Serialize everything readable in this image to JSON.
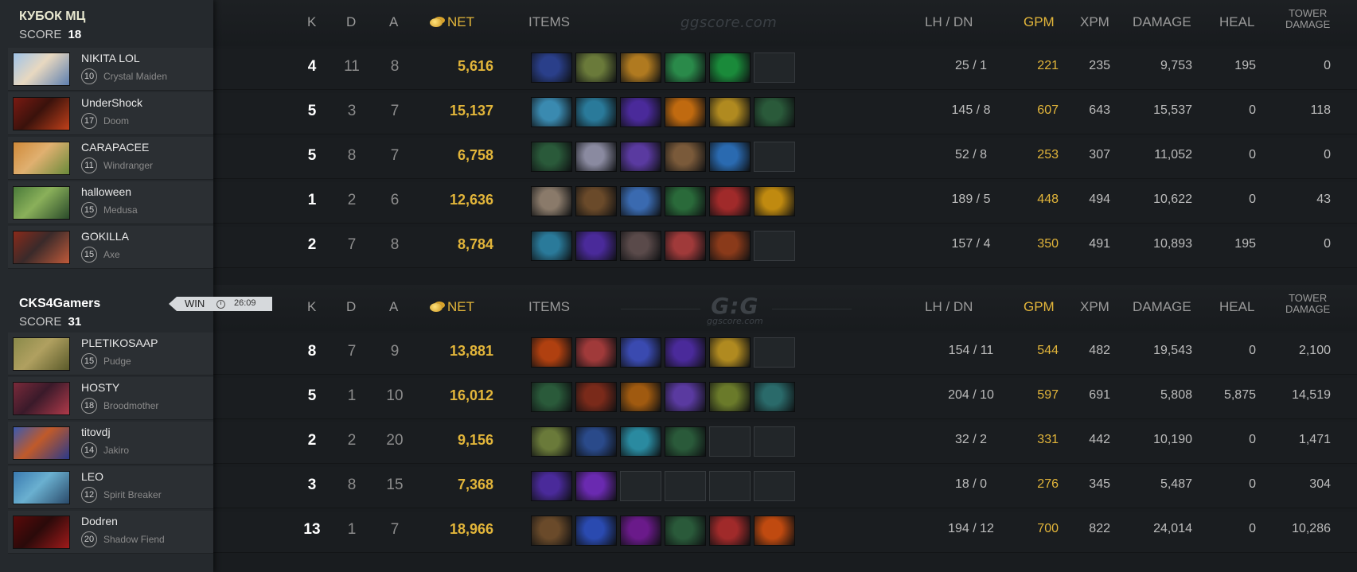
{
  "columns": {
    "k": "K",
    "d": "D",
    "a": "A",
    "net": "NET",
    "items": "ITEMS",
    "lhdn": "LH  /  DN",
    "gpm": "GPM",
    "xpm": "XPM",
    "damage": "DAMAGE",
    "heal": "HEAL",
    "tower_line1": "TOWER",
    "tower_line2": "DAMAGE"
  },
  "watermark_top": "ggscore.com",
  "watermark_mid_big": "G:G",
  "watermark_mid_small": "ggscore.com",
  "result": {
    "label": "WIN",
    "time": "26:09"
  },
  "teams": [
    {
      "name": "КУБОК МЦ",
      "score_label": "SCORE",
      "score": "18",
      "players": [
        {
          "name": "NIKITA LOL",
          "level": "10",
          "hero": "Crystal Maiden",
          "k": "4",
          "d": "11",
          "a": "8",
          "net": "5,616",
          "lhdn": "25  /  1",
          "gpm": "221",
          "xpm": "235",
          "damage": "9,753",
          "heal": "195",
          "tower": "0",
          "avatar": [
            "#9fc3e8",
            "#e8d8c0",
            "#5d7fb0"
          ],
          "items": [
            "#2a3f8a",
            "#6a7a3a",
            "#b07a20",
            "#2a8a4a",
            "#1a8a3a",
            "empty"
          ]
        },
        {
          "name": "UnderShock",
          "level": "17",
          "hero": "Doom",
          "k": "5",
          "d": "3",
          "a": "7",
          "net": "15,137",
          "lhdn": "145  /  8",
          "gpm": "607",
          "xpm": "643",
          "damage": "15,537",
          "heal": "0",
          "tower": "118",
          "avatar": [
            "#7a1a12",
            "#3a120c",
            "#c0401a"
          ],
          "items": [
            "#3a8ab0",
            "#2a7a9a",
            "#4a2a9a",
            "#c06a10",
            "#b08a20",
            "#2a5a3a"
          ]
        },
        {
          "name": "CARAPACEE",
          "level": "11",
          "hero": "Windranger",
          "k": "5",
          "d": "8",
          "a": "7",
          "net": "6,758",
          "lhdn": "52  /  8",
          "gpm": "253",
          "xpm": "307",
          "damage": "11,052",
          "heal": "0",
          "tower": "0",
          "avatar": [
            "#d08a3a",
            "#e0b070",
            "#6a8a3a"
          ],
          "items": [
            "#2a5a3a",
            "#8a8aa0",
            "#5a3aa0",
            "#7a5a3a",
            "#2a6ab0",
            "empty"
          ]
        },
        {
          "name": "halloween",
          "level": "15",
          "hero": "Medusa",
          "k": "1",
          "d": "2",
          "a": "6",
          "net": "12,636",
          "lhdn": "189  /  5",
          "gpm": "448",
          "xpm": "494",
          "damage": "10,622",
          "heal": "0",
          "tower": "43",
          "avatar": [
            "#4a7a3a",
            "#8ab05a",
            "#2a4a2a"
          ],
          "items": [
            "#8a7a6a",
            "#6a4a2a",
            "#3a6ab0",
            "#2a6a3a",
            "#a02a2a",
            "#c08a10"
          ]
        },
        {
          "name": "GOKILLA",
          "level": "15",
          "hero": "Axe",
          "k": "2",
          "d": "7",
          "a": "8",
          "net": "8,784",
          "lhdn": "157  /  4",
          "gpm": "350",
          "xpm": "491",
          "damage": "10,893",
          "heal": "195",
          "tower": "0",
          "avatar": [
            "#8a2a1a",
            "#3a2a2a",
            "#c05a3a"
          ],
          "items": [
            "#2a7a9a",
            "#4a2a9a",
            "#5a4a4a",
            "#a03a3a",
            "#8a3a1a",
            "empty"
          ]
        }
      ]
    },
    {
      "name": "CKS4Gamers",
      "score_label": "SCORE",
      "score": "31",
      "players": [
        {
          "name": "PLETIKOSAAP",
          "level": "15",
          "hero": "Pudge",
          "k": "8",
          "d": "7",
          "a": "9",
          "net": "13,881",
          "lhdn": "154  /  11",
          "gpm": "544",
          "xpm": "482",
          "damage": "19,543",
          "heal": "0",
          "tower": "2,100",
          "avatar": [
            "#8a8a4a",
            "#b0a060",
            "#5a5a2a"
          ],
          "items": [
            "#b04010",
            "#a03a3a",
            "#3a4ab0",
            "#4a2a9a",
            "#b08a20",
            "empty"
          ]
        },
        {
          "name": "HOSTY",
          "level": "18",
          "hero": "Broodmother",
          "k": "5",
          "d": "1",
          "a": "10",
          "net": "16,012",
          "lhdn": "204  /  10",
          "gpm": "597",
          "xpm": "691",
          "damage": "5,808",
          "heal": "5,875",
          "tower": "14,519",
          "avatar": [
            "#7a2a3a",
            "#3a1a2a",
            "#b03a4a"
          ],
          "items": [
            "#2a5a3a",
            "#7a2a1a",
            "#a05a10",
            "#5a3aa0",
            "#6a7a2a",
            "#2a6a6a"
          ]
        },
        {
          "name": "titovdj",
          "level": "14",
          "hero": "Jakiro",
          "k": "2",
          "d": "2",
          "a": "20",
          "net": "9,156",
          "lhdn": "32  /  2",
          "gpm": "331",
          "xpm": "442",
          "damage": "10,190",
          "heal": "0",
          "tower": "1,471",
          "avatar": [
            "#3a5ab0",
            "#c05a2a",
            "#2a3a8a"
          ],
          "items": [
            "#6a7a3a",
            "#2a4a8a",
            "#2a8aa0",
            "#2a5a3a",
            "empty",
            "empty"
          ]
        },
        {
          "name": "LEO",
          "level": "12",
          "hero": "Spirit Breaker",
          "k": "3",
          "d": "8",
          "a": "15",
          "net": "7,368",
          "lhdn": "18  /  0",
          "gpm": "276",
          "xpm": "345",
          "damage": "5,487",
          "heal": "0",
          "tower": "304",
          "avatar": [
            "#3a7ab0",
            "#6ab0d0",
            "#2a4a6a"
          ],
          "items": [
            "#4a2a9a",
            "#6a2ab0",
            "empty",
            "empty",
            "empty",
            "empty"
          ]
        },
        {
          "name": "Dodren",
          "level": "20",
          "hero": "Shadow Fiend",
          "k": "13",
          "d": "1",
          "a": "7",
          "net": "18,966",
          "lhdn": "194  /  12",
          "gpm": "700",
          "xpm": "822",
          "damage": "24,014",
          "heal": "0",
          "tower": "10,286",
          "avatar": [
            "#5a0a0a",
            "#2a0a0a",
            "#a01a1a"
          ],
          "items": [
            "#6a4a2a",
            "#2a4ab0",
            "#6a1a8a",
            "#2a5a3a",
            "#a02a2a",
            "#c04a10"
          ]
        }
      ]
    }
  ]
}
